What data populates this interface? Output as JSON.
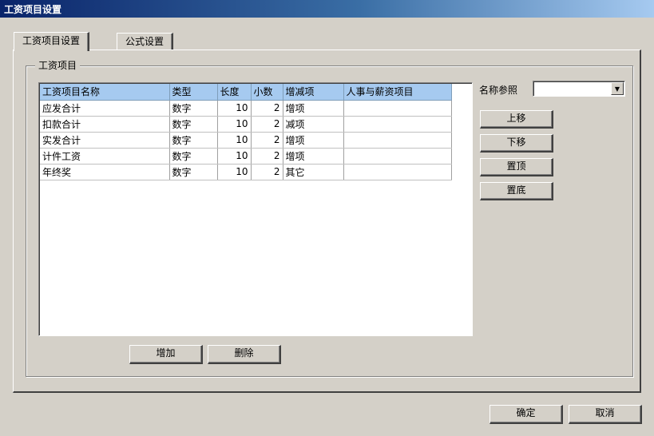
{
  "window": {
    "title": "工资项目设置"
  },
  "tabs": [
    {
      "label": "工资项目设置",
      "active": true
    },
    {
      "label": "公式设置",
      "active": false
    }
  ],
  "group": {
    "label": "工资项目"
  },
  "grid": {
    "columns": [
      "工资项目名称",
      "类型",
      "长度",
      "小数",
      "增减项",
      "人事与薪资项目"
    ],
    "rows": [
      [
        "应发合计",
        "数字",
        "10",
        "2",
        "增项",
        ""
      ],
      [
        "扣款合计",
        "数字",
        "10",
        "2",
        "减项",
        ""
      ],
      [
        "实发合计",
        "数字",
        "10",
        "2",
        "增项",
        ""
      ],
      [
        "计件工资",
        "数字",
        "10",
        "2",
        "增项",
        ""
      ],
      [
        "年终奖",
        "数字",
        "10",
        "2",
        "其它",
        ""
      ]
    ]
  },
  "name_ref": {
    "label": "名称参照",
    "value": ""
  },
  "side_buttons": {
    "up": "上移",
    "down": "下移",
    "top": "置顶",
    "bottom": "置底"
  },
  "grid_buttons": {
    "add": "增加",
    "delete": "删除"
  },
  "footer_buttons": {
    "ok": "确定",
    "cancel": "取消"
  },
  "icons": {
    "dropdown": "triangle-down"
  }
}
